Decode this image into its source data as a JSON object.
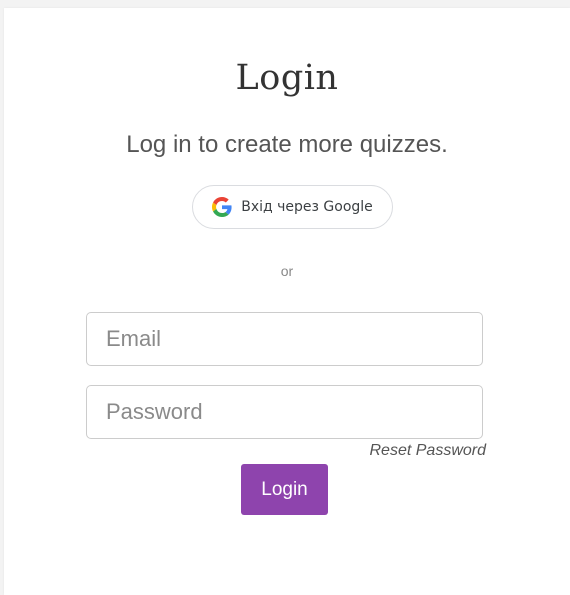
{
  "login": {
    "title": "Login",
    "subtitle": "Log in to create more quizzes.",
    "google_button_label": "Вхід через Google",
    "divider_text": "or",
    "email_placeholder": "Email",
    "password_placeholder": "Password",
    "reset_password_label": "Reset Password",
    "submit_label": "Login",
    "accent_color": "#8e44ad",
    "google_icon": "google-g-icon"
  }
}
